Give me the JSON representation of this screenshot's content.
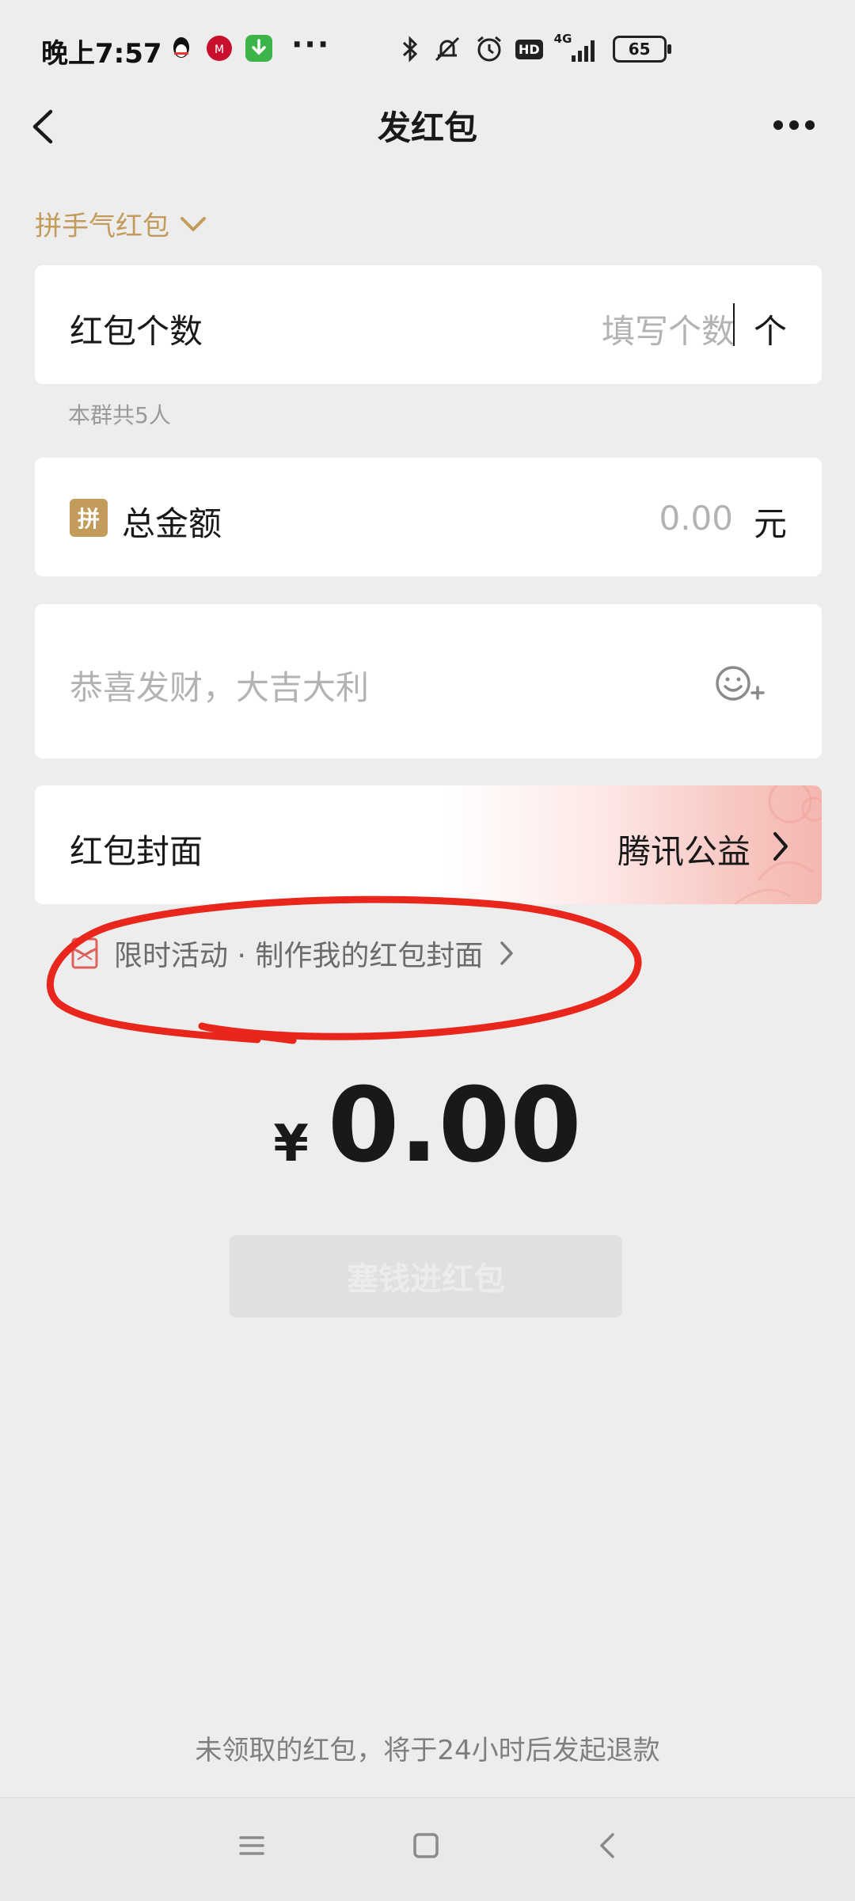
{
  "status_bar": {
    "time": "晚上7:57",
    "more": "···",
    "network": "4G",
    "hd": "HD",
    "battery": "65",
    "app_icons": [
      "qq-icon",
      "china-merchants-bank-icon",
      "download-icon"
    ]
  },
  "header": {
    "title": "发红包"
  },
  "type_selector": {
    "label": "拼手气红包"
  },
  "count_field": {
    "label": "红包个数",
    "placeholder": "填写个数",
    "unit": "个",
    "hint": "本群共5人"
  },
  "amount_field": {
    "badge": "拼",
    "label": "总金额",
    "value": "0.00",
    "unit": "元"
  },
  "greeting": {
    "placeholder": "恭喜发财，大吉大利"
  },
  "cover": {
    "label": "红包封面",
    "value": "腾讯公益"
  },
  "activity": {
    "label": "限时活动 · 制作我的红包封面"
  },
  "total": {
    "currency": "¥",
    "value": "0.00"
  },
  "send_button": {
    "label": "塞钱进红包"
  },
  "footer": {
    "note": "未领取的红包，将于24小时后发起退款"
  },
  "colors": {
    "background": "#ededed",
    "accent_gold": "#c39b5a",
    "annotation_red": "#e8261c",
    "placeholder": "#b3b3b3"
  }
}
